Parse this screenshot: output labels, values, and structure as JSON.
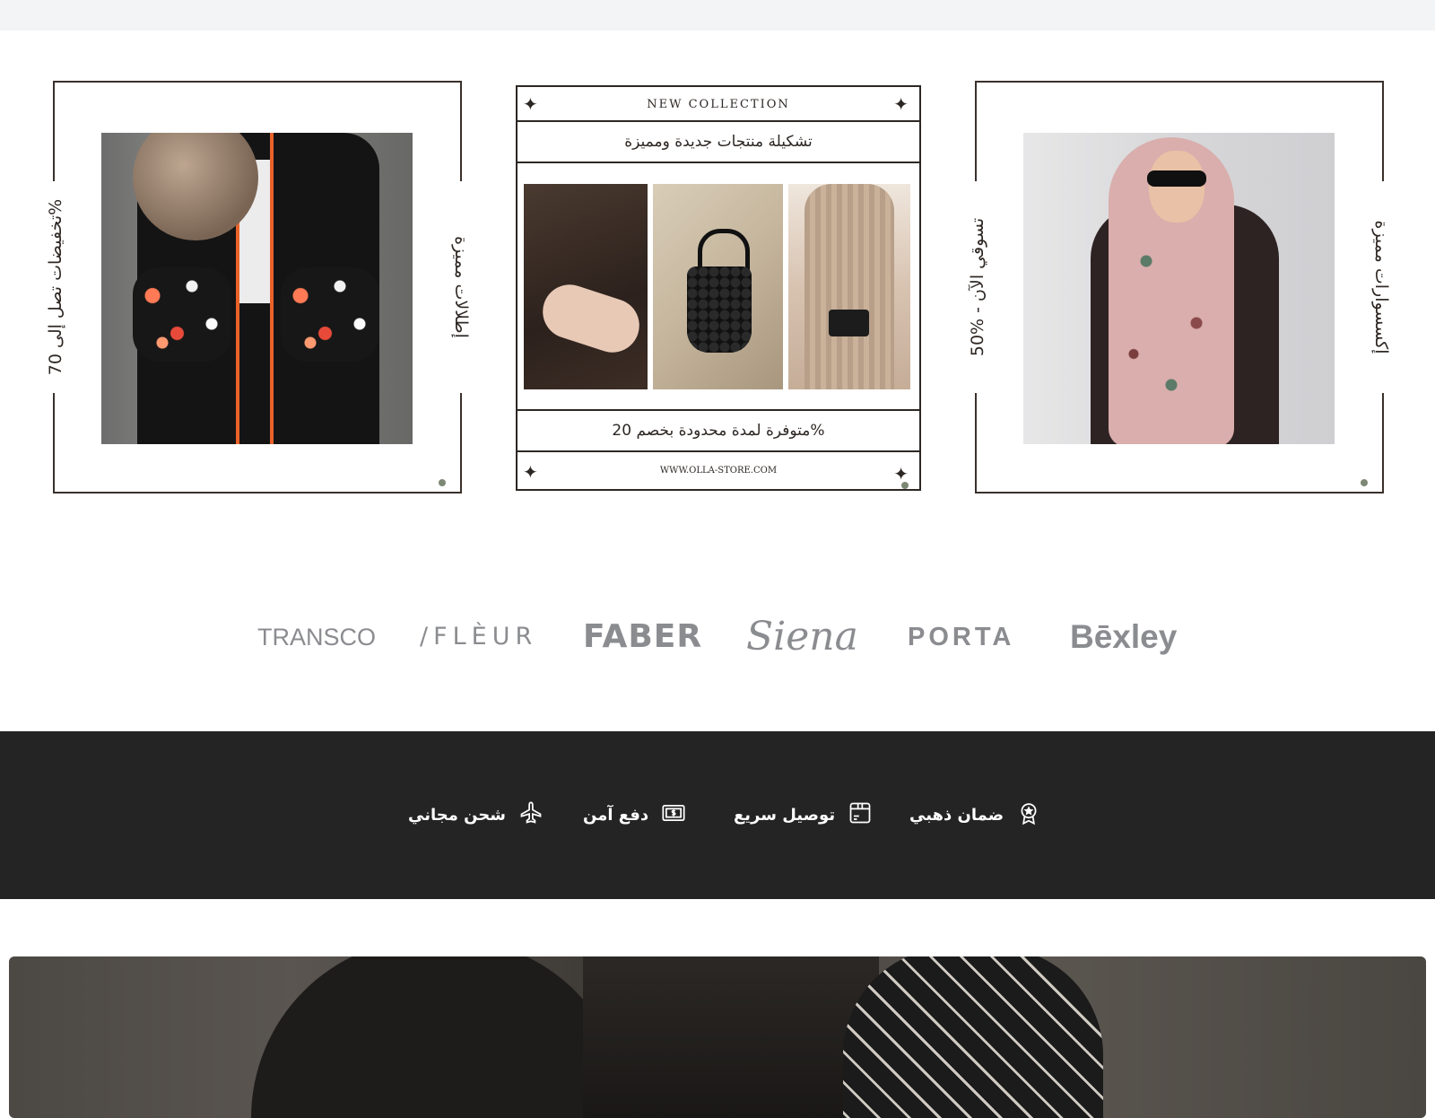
{
  "banners": {
    "left": {
      "text_outer": "تخفيضات تصل إلى 70%",
      "text_inner": "إطلالات مميزة",
      "image_alt": "abaya with floral embroidered sleeves"
    },
    "center": {
      "eyebrow": "NEW COLLECTION",
      "headline": "تشكيلة منتجات جديدة ومميزة",
      "offer": "متوفرة لمدة محدودة بخصم 20%",
      "url": "WWW.OLLA-STORE.COM",
      "star_glyph": "✦"
    },
    "right": {
      "text_inner": "50% - تسوقي الآن",
      "text_outer": "إكسسوارات مميزة",
      "image_alt": "woman in floral hijab and sunglasses"
    }
  },
  "brands": [
    "TRANSCO",
    "/FLÈUR",
    "FABER",
    "Siena",
    "PORTA",
    "Bēxley"
  ],
  "features": [
    {
      "label": "ضمان ذهبي",
      "icon": "badge-icon"
    },
    {
      "label": "توصيل سريع",
      "icon": "box-icon"
    },
    {
      "label": "دفع آمن",
      "icon": "money-icon"
    },
    {
      "label": "شحن مجاني",
      "icon": "airplane-icon"
    }
  ],
  "colors": {
    "frame": "#3a302b",
    "features_bg": "#242424",
    "brand_gray": "#8b8c90",
    "dot": "#7d8874"
  }
}
